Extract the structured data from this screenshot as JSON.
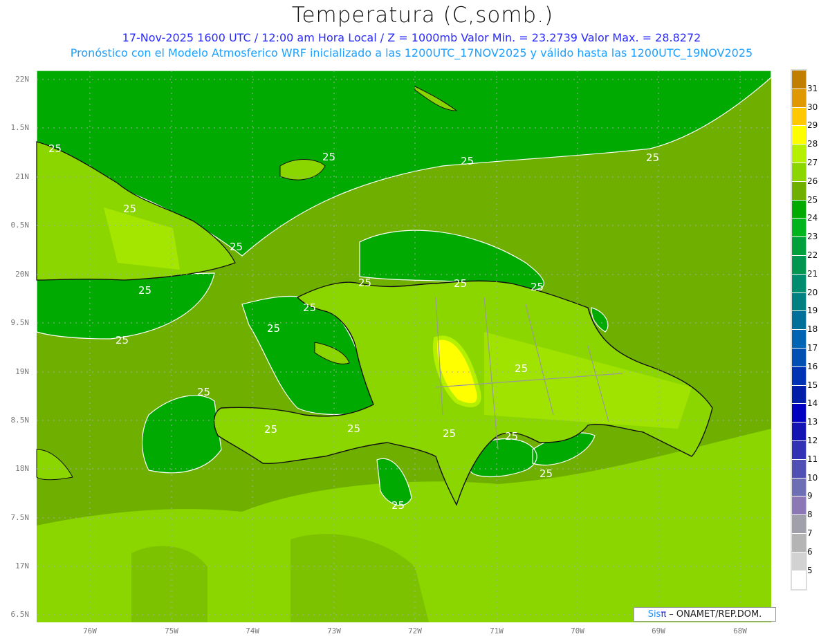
{
  "header": {
    "title": "Temperatura (C,somb.)",
    "subtitle": "17-Nov-2025 1600 UTC / 12:00 am Hora Local / Z = 1000mb   Valor Min. = 23.2739   Valor Max. = 28.8272",
    "forecast_info": "Pronóstico con el Modelo Atmosferico WRF inicializado a las 1200UTC_17NOV2025 y válido hasta las  1200UTC_19NOV2025"
  },
  "axes": {
    "lat_labels": [
      "22N",
      "1.5N",
      "21N",
      "0.5N",
      "20N",
      "9.5N",
      "19N",
      "8.5N",
      "18N",
      "7.5N",
      "17N",
      "6.5N"
    ],
    "lon_labels": [
      "76W",
      "75W",
      "74W",
      "73W",
      "72W",
      "71W",
      "70W",
      "69W",
      "68W"
    ]
  },
  "contour_label": "25",
  "colorbar": {
    "labels": [
      "31",
      "30",
      "29",
      "28",
      "27",
      "26",
      "25",
      "24",
      "23",
      "22",
      "21",
      "20",
      "19",
      "18",
      "17",
      "16",
      "15",
      "14",
      "13",
      "12",
      "11",
      "10",
      "9",
      "8",
      "7",
      "6",
      "5"
    ],
    "colors": [
      "#c07f00",
      "#e09800",
      "#ffc800",
      "#ffff00",
      "#b4f000",
      "#8cd600",
      "#6eaf00",
      "#00aa00",
      "#00b41e",
      "#00a03c",
      "#009650",
      "#008c6e",
      "#008080",
      "#00709a",
      "#0064b4",
      "#0050b4",
      "#0032b4",
      "#001ea8",
      "#0000c0",
      "#1414b4",
      "#3232b4",
      "#5050b4",
      "#6e6eb4",
      "#8c78b4",
      "#a0a0aa",
      "#b4b4b4",
      "#d2d2d2",
      "#ffffff"
    ]
  },
  "credit": {
    "sis": "Sis",
    "pi": "π",
    "org": " – ONAMET/REP.DOM."
  }
}
